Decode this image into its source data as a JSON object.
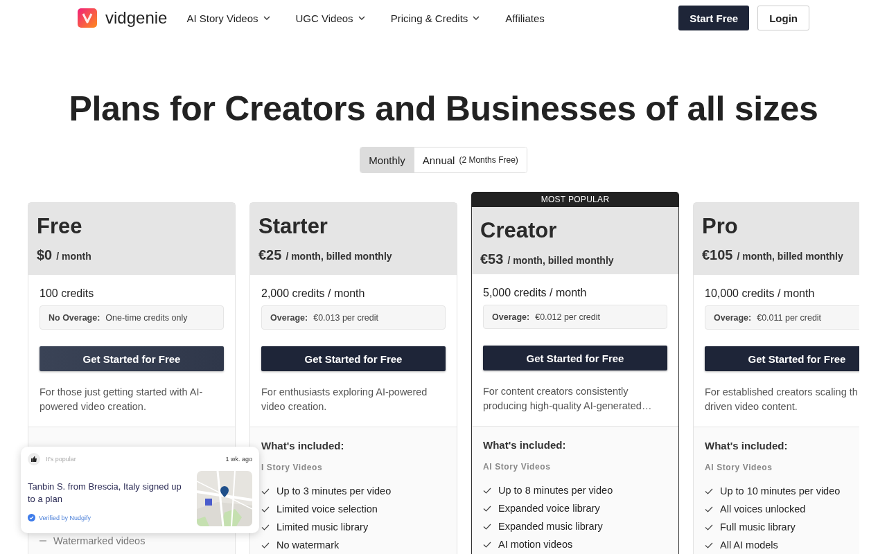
{
  "header": {
    "brand": "vidgenie",
    "nav": [
      {
        "label": "AI Story Videos",
        "dropdown": true
      },
      {
        "label": "UGC Videos",
        "dropdown": true
      },
      {
        "label": "Pricing & Credits",
        "dropdown": true
      },
      {
        "label": "Affiliates",
        "dropdown": false
      }
    ],
    "start_button": "Start Free",
    "login_button": "Login"
  },
  "title": "Plans for Creators and Businesses of all sizes",
  "billing_toggle": [
    {
      "label": "Monthly",
      "selected": true
    },
    {
      "label": "Annual",
      "note": "(2 Months Free)",
      "selected": false
    }
  ],
  "popular_label": "MOST POPULAR",
  "plans": [
    {
      "name": "Free",
      "price": "$0",
      "period": "/ month",
      "popular": false,
      "credits": "100 credits",
      "overage_label": "No Overage:",
      "overage_value": "One-time credits only",
      "button": "Get Started for Free",
      "button_hovered": true,
      "description": [
        "For those just getting started with AI-",
        "powered video creation."
      ],
      "features": [
        {
          "text": "Watermarked videos",
          "included": false
        }
      ]
    },
    {
      "name": "Starter",
      "price": "€25",
      "period": "/ month, billed monthly",
      "popular": false,
      "credits": "2,000 credits / month",
      "overage_label": "Overage:",
      "overage_value": "€0.013 per credit",
      "button": "Get Started for Free",
      "button_hovered": false,
      "description": [
        "For enthusiasts exploring AI-powered",
        "video creation."
      ],
      "included_heading": "What's included:",
      "category": "I Story Videos",
      "features": [
        {
          "text": "Up to 3 minutes per video",
          "included": true
        },
        {
          "text": "Limited voice selection",
          "included": true
        },
        {
          "text": "Limited music library",
          "included": true
        },
        {
          "text": "No watermark",
          "included": true
        }
      ]
    },
    {
      "name": "Creator",
      "price": "€53",
      "period": "/ month, billed monthly",
      "popular": true,
      "credits": "5,000 credits / month",
      "overage_label": "Overage:",
      "overage_value": "€0.012 per credit",
      "button": "Get Started for Free",
      "button_hovered": false,
      "description": [
        "For content creators consistently",
        "producing high-quality AI-generated…"
      ],
      "included_heading": "What's included:",
      "category": "AI Story Videos",
      "features": [
        {
          "text": "Up to 8 minutes per video",
          "included": true
        },
        {
          "text": "Expanded voice library",
          "included": true
        },
        {
          "text": "Expanded music library",
          "included": true
        },
        {
          "text": "AI motion videos",
          "included": true
        }
      ]
    },
    {
      "name": "Pro",
      "price": "€105",
      "period": "/ month, billed monthly",
      "popular": false,
      "credits": "10,000 credits / month",
      "overage_label": "Overage:",
      "overage_value": "€0.011 per credit",
      "button": "Get Started for Free",
      "button_hovered": false,
      "description": [
        "For established creators scaling th",
        "driven video content."
      ],
      "included_heading": "What's included:",
      "category": "AI Story Videos",
      "features": [
        {
          "text": "Up to 10 minutes per video",
          "included": true
        },
        {
          "text": "All voices unlocked",
          "included": true
        },
        {
          "text": "Full music library",
          "included": true
        },
        {
          "text": "All AI models",
          "included": true
        }
      ]
    }
  ],
  "notification": {
    "label": "It's popular",
    "time": "1 wk. ago",
    "message": "Tanbin S. from Brescia, Italy signed up to a plan",
    "verified": "Verified by Nudgify"
  }
}
